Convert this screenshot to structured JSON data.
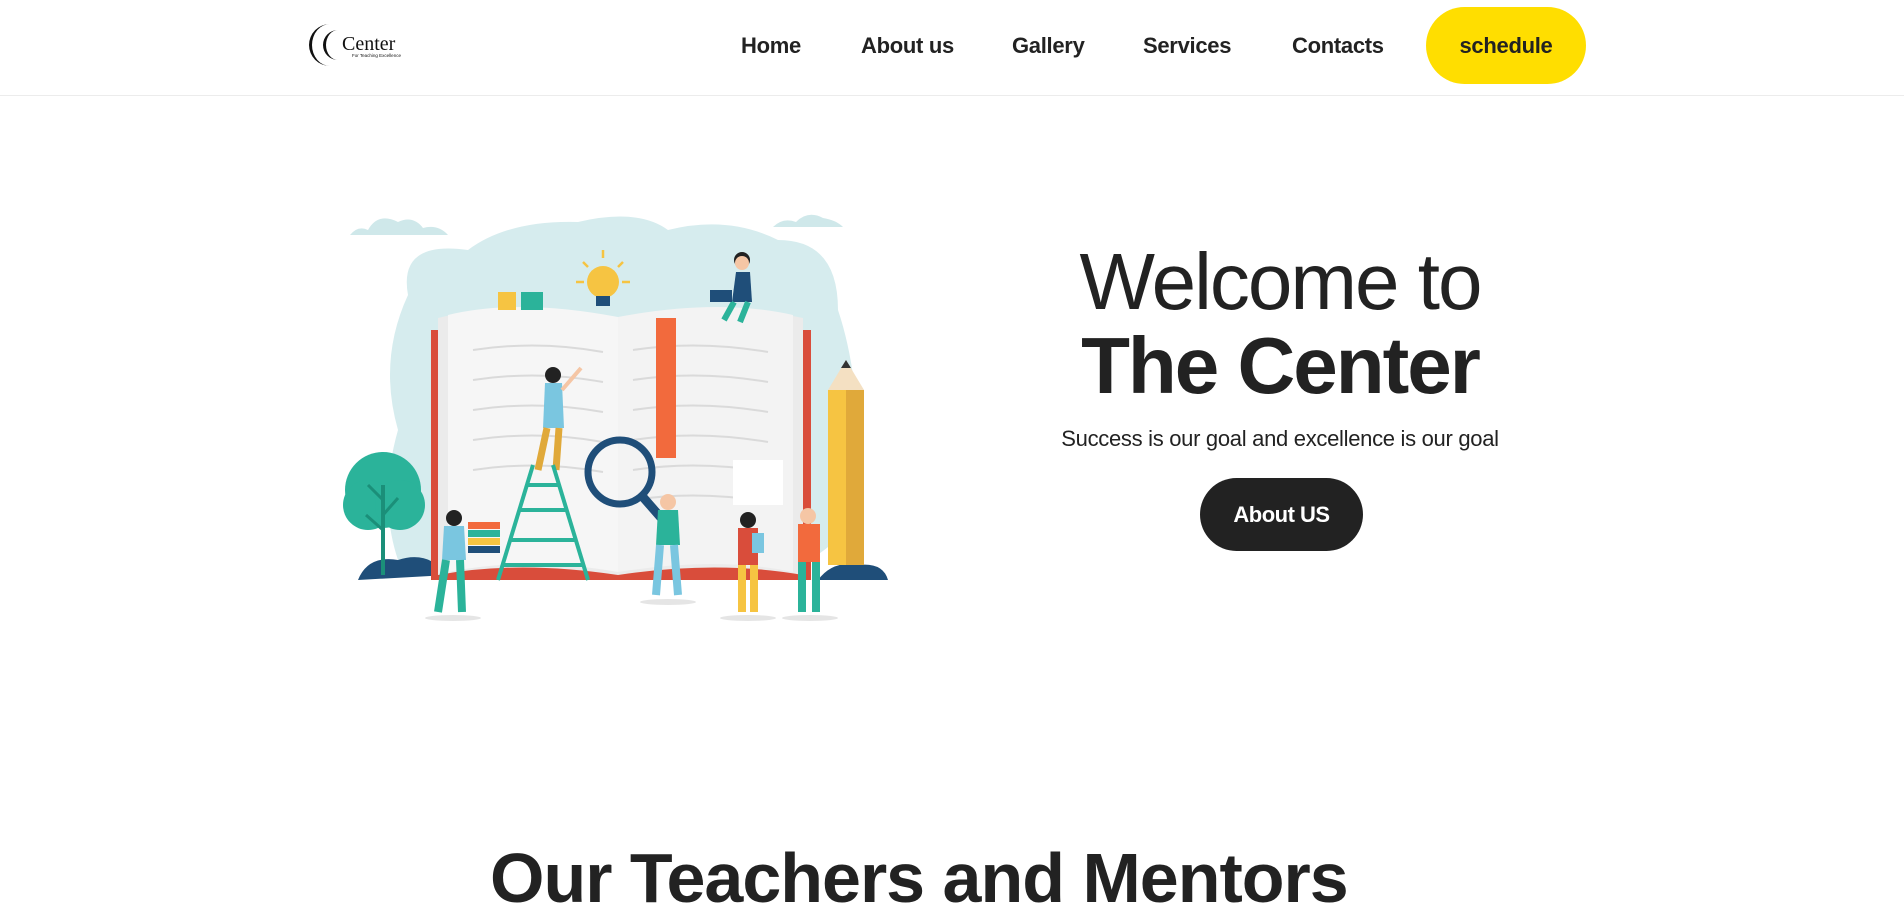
{
  "header": {
    "logo": {
      "text": "Center",
      "tagline": "For Teaching Excellence",
      "icon": "crescent-logo-icon"
    },
    "nav": [
      "Home",
      "About us",
      "Gallery",
      "Services",
      "Contacts"
    ],
    "schedule_label": "schedule"
  },
  "hero": {
    "title_line1": "Welcome to",
    "title_line2": "The Center",
    "subtitle": "Success is our goal and excellence is our goal",
    "button_label": "About US",
    "illustration": "open-book-learning-illustration"
  },
  "next_section": {
    "heading_partial": "Our Teachers and Mentors"
  },
  "colors": {
    "accent_yellow": "#ffde00",
    "dark": "#222222",
    "background": "#ffffff"
  }
}
